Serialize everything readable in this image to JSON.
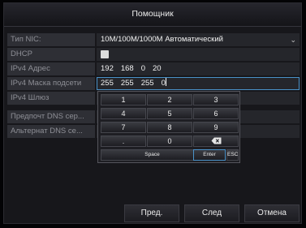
{
  "dialog": {
    "title": "Помощник"
  },
  "form": {
    "nic_label": "Тип NIC:",
    "nic_value": "10M/100M/1000M Автоматический",
    "dhcp_label": "DHCP",
    "ipv4_addr_label": "IPv4 Адрес",
    "ipv4_addr_octets": [
      "192",
      "168",
      "0",
      "20"
    ],
    "ipv4_mask_label": "IPv4 Маска подсети",
    "ipv4_mask_octets": [
      "255",
      "255",
      "255",
      "0"
    ],
    "ipv4_gw_label": "IPv4 Шлюз",
    "dns_pref_label": "Предпочт DNS сер...",
    "dns_alt_label": "Альтернат DNS се..."
  },
  "keypad": {
    "keys": [
      "1",
      "2",
      "3",
      "4",
      "5",
      "6",
      "7",
      "8",
      "9",
      ".",
      "0"
    ],
    "space": "Space",
    "enter": "Enter",
    "esc": "ESC"
  },
  "footer": {
    "prev": "Пред.",
    "next": "След",
    "cancel": "Отмена"
  },
  "colors": {
    "accent": "#4a92c8"
  }
}
